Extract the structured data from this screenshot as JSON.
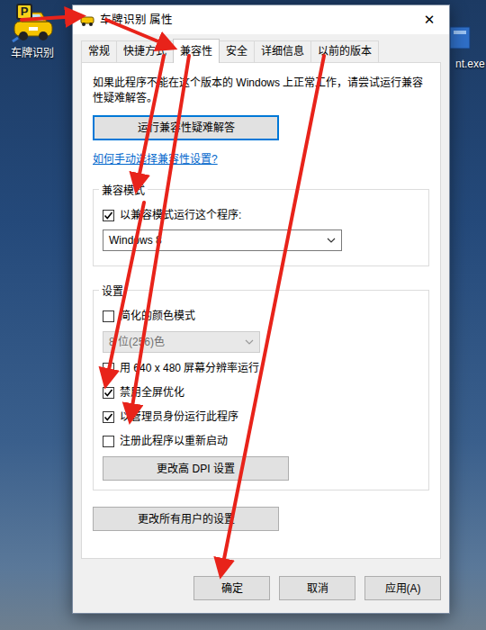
{
  "desktop": {
    "icons": [
      {
        "label": "车牌识别",
        "badge": "P"
      },
      {
        "label": "nt.exe"
      }
    ]
  },
  "window": {
    "title": "车牌识别 属性",
    "close": "✕"
  },
  "tabs": [
    {
      "label": "常规",
      "selected": false
    },
    {
      "label": "快捷方式",
      "selected": false
    },
    {
      "label": "兼容性",
      "selected": true
    },
    {
      "label": "安全",
      "selected": false
    },
    {
      "label": "详细信息",
      "selected": false
    },
    {
      "label": "以前的版本",
      "selected": false
    }
  ],
  "intro": "如果此程序不能在这个版本的 Windows 上正常工作，请尝试运行兼容性疑难解答。",
  "troubleshoot_button": "运行兼容性疑难解答",
  "help_link": "如何手动选择兼容性设置?",
  "compat_group": {
    "title": "兼容模式",
    "checkbox": {
      "label": "以兼容模式运行这个程序:",
      "checked": true
    },
    "select": {
      "value": "Windows 8",
      "disabled": false
    }
  },
  "settings_group": {
    "title": "设置",
    "items": [
      {
        "kind": "checkbox",
        "label": "简化的颜色模式",
        "checked": false
      },
      {
        "kind": "select",
        "label": "8 位(256)色",
        "disabled": true
      },
      {
        "kind": "checkbox",
        "label": "用 640 x 480 屏幕分辨率运行",
        "checked": false
      },
      {
        "kind": "checkbox",
        "label": "禁用全屏优化",
        "checked": true
      },
      {
        "kind": "checkbox",
        "label": "以管理员身份运行此程序",
        "checked": true
      },
      {
        "kind": "checkbox",
        "label": "注册此程序以重新启动",
        "checked": false
      },
      {
        "kind": "button",
        "label": "更改高 DPI 设置"
      }
    ]
  },
  "all_users_button": "更改所有用户的设置",
  "buttons": [
    {
      "label": "确定"
    },
    {
      "label": "取消"
    },
    {
      "label": "应用(A)"
    }
  ]
}
